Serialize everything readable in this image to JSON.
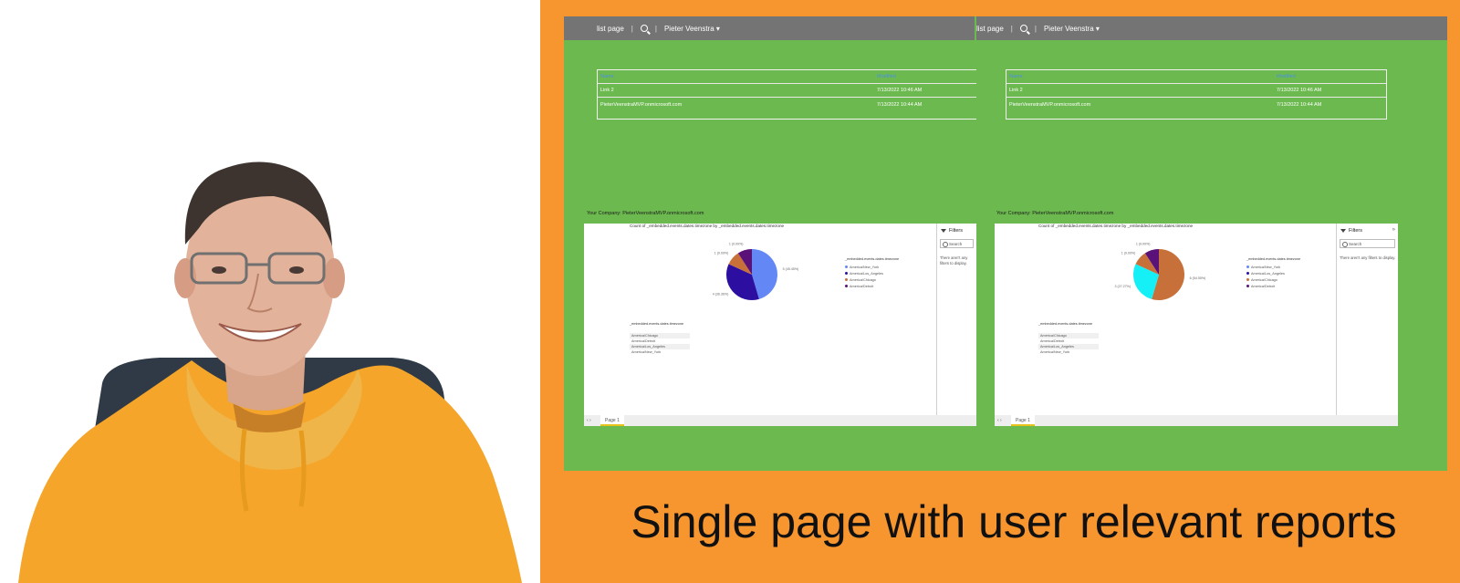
{
  "slide": {
    "caption": "Single page with user relevant reports",
    "colors": {
      "slide_bg": "#f7952f",
      "panel_bg": "#6cba4f",
      "topbar_bg": "#747474"
    }
  },
  "screens": [
    {
      "topbar": {
        "page_link": "list page",
        "separator": "|",
        "user_menu": "Pieter Veenstra ▾"
      },
      "links_table": {
        "header_name": "Name",
        "header_date": "Modified",
        "rows": [
          {
            "name": "Link 2",
            "date": "7/13/2022 10:46 AM"
          },
          {
            "name": "PieterVeenstraMVP.onmicrosoft.com",
            "date": "7/13/2022 10:44 AM"
          }
        ]
      },
      "company_line": "Your Company: PieterVeenstraMVP.onmicrosoft.com",
      "report": {
        "chart_title": "Count of _embedded.events.dates.timezone by _embedded.events.dates.timezone",
        "legend_title": "_embedded.events.dates.timezone",
        "legend_items": [
          "America/New_York",
          "America/Los_Angeles",
          "America/Chicago",
          "America/Detroit"
        ],
        "slicer_title": "_embedded.events.dates.timezone",
        "slicer_items": [
          "America/Chicago",
          "America/Detroit",
          "America/Los_Angeles",
          "America/New_York"
        ],
        "page_tab": "Page 1",
        "page_nav": "‹ ›",
        "filters_label": "Filters",
        "filters_search": "Search",
        "filters_empty": "There aren't any filters to display."
      },
      "chart_data": {
        "type": "pie",
        "title": "Count of _embedded.events.dates.timezone by _embedded.events.dates.timezone",
        "categories": [
          "America/New_York",
          "America/Los_Angeles",
          "America/Chicago",
          "America/Detroit"
        ],
        "values": [
          5,
          4,
          1,
          1
        ],
        "colors": [
          "#6388f5",
          "#2c0fa0",
          "#c8703a",
          "#5a1178"
        ],
        "data_labels": [
          "5 (45.45%)",
          "4 (36.36%)",
          "1 (9.09%)",
          "1 (9.09%)"
        ],
        "legend": "right"
      }
    },
    {
      "topbar": {
        "page_link": "list page",
        "separator": "|",
        "user_menu": "Pieter Veenstra ▾"
      },
      "links_table": {
        "header_name": "Name",
        "header_date": "Modified",
        "rows": [
          {
            "name": "Link 2",
            "date": "7/13/2022 10:46 AM"
          },
          {
            "name": "PieterVeenstraMVP.onmicrosoft.com",
            "date": "7/13/2022 10:44 AM"
          }
        ]
      },
      "company_line": "Your Company: PieterVeenstraMVP.onmicrosoft.com",
      "report": {
        "chart_title": "Count of _embedded.events.dates.timezone by _embedded.events.dates.timezone",
        "legend_title": "_embedded.events.dates.timezone",
        "legend_items": [
          "America/New_York",
          "America/Los_Angeles",
          "America/Chicago",
          "America/Detroit"
        ],
        "slicer_title": "_embedded.events.dates.timezone",
        "slicer_items": [
          "America/Chicago",
          "America/Detroit",
          "America/Los_Angeles",
          "America/New_York"
        ],
        "page_tab": "Page 1",
        "page_nav": "‹ ›",
        "filters_label": "Filters",
        "filters_search": "Search",
        "filters_empty": "There aren't any filters to display."
      },
      "chart_data": {
        "type": "pie",
        "title": "Count of _embedded.events.dates.timezone by _embedded.events.dates.timezone",
        "categories": [
          "America/Chicago",
          "America/Los_Angeles",
          "America/Detroit",
          "America/New_York"
        ],
        "values": [
          6,
          3,
          1,
          1
        ],
        "colors": [
          "#c8703a",
          "#15f0f7",
          "#c8703a",
          "#5a1178"
        ],
        "data_labels": [
          "6 (54.55%)",
          "3 (27.27%)",
          "1 (9.09%)",
          "1 (9.09%)"
        ],
        "legend": "right"
      }
    }
  ]
}
